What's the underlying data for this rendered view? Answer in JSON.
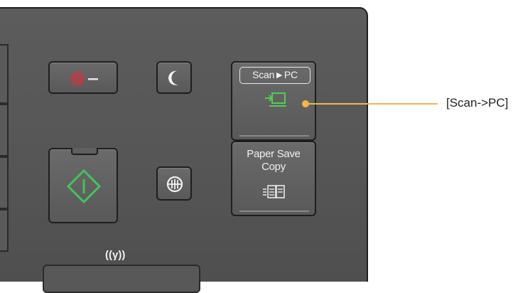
{
  "panel": {
    "buttons": {
      "scan_pc": {
        "label": "Scan►PC",
        "icon": "scan-to-pc-icon"
      },
      "paper_save": {
        "label_line1": "Paper Save",
        "label_line2": "Copy",
        "icon": "paper-save-copy-icon"
      },
      "stop": {
        "icon": "stop-icon"
      },
      "sleep": {
        "icon": "moon-icon"
      },
      "start": {
        "icon": "start-diamond-icon"
      },
      "id_copy": {
        "icon": "id-copy-icon"
      }
    },
    "wifi": {
      "label": "((γ))"
    }
  },
  "callout": {
    "text": "[Scan->PC]"
  },
  "colors": {
    "panel": "#565656",
    "stop_red": "#d8303a",
    "start_green": "#43c45a",
    "scan_icon_green": "#4fcf52",
    "callout": "#f2b64a"
  }
}
